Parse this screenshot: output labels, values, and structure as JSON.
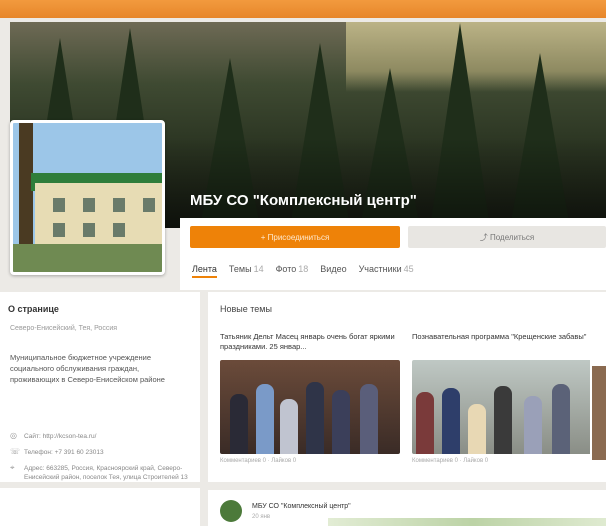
{
  "group": {
    "title": "МБУ СО \"Комплексный центр\""
  },
  "actions": {
    "join_label": "+ Присоединиться",
    "share_label": "⤴ Поделиться"
  },
  "tabs": [
    {
      "label": "Лента",
      "count": ""
    },
    {
      "label": "Темы",
      "count": "14"
    },
    {
      "label": "Фото",
      "count": "18"
    },
    {
      "label": "Видео",
      "count": ""
    },
    {
      "label": "Участники",
      "count": "45"
    }
  ],
  "about": {
    "heading": "О странице",
    "location": "Северо-Енисейский, Тея, Россия",
    "description": "Муниципальное бюджетное учреждение социального обслуживания граждан, проживающих в Северо-Енисейском районе",
    "site": "Сайт: http://kcson-tea.ru/",
    "phone": "Телефон: +7 391 60 23013",
    "address": "Адрес: 663285, Россия, Красноярский край, Северо-Енисейский район, поселок Тея, улица Строителей 13"
  },
  "topics": {
    "heading": "Новые темы",
    "items": [
      {
        "title": "Татьяник Дельт Масец январь очень богат яркими праздниками. 25 январ...",
        "meta": "Комментариев 0 · Лайков 0"
      },
      {
        "title": "Познавательная программа \"Крещенские забавы\"",
        "meta": "Комментариев 0 · Лайков 0"
      }
    ]
  },
  "post": {
    "author": "МБУ СО \"Комплексный центр\"",
    "date": "20 янв"
  },
  "colors": {
    "accent": "#ee8208",
    "topbar": "#e7862a"
  }
}
